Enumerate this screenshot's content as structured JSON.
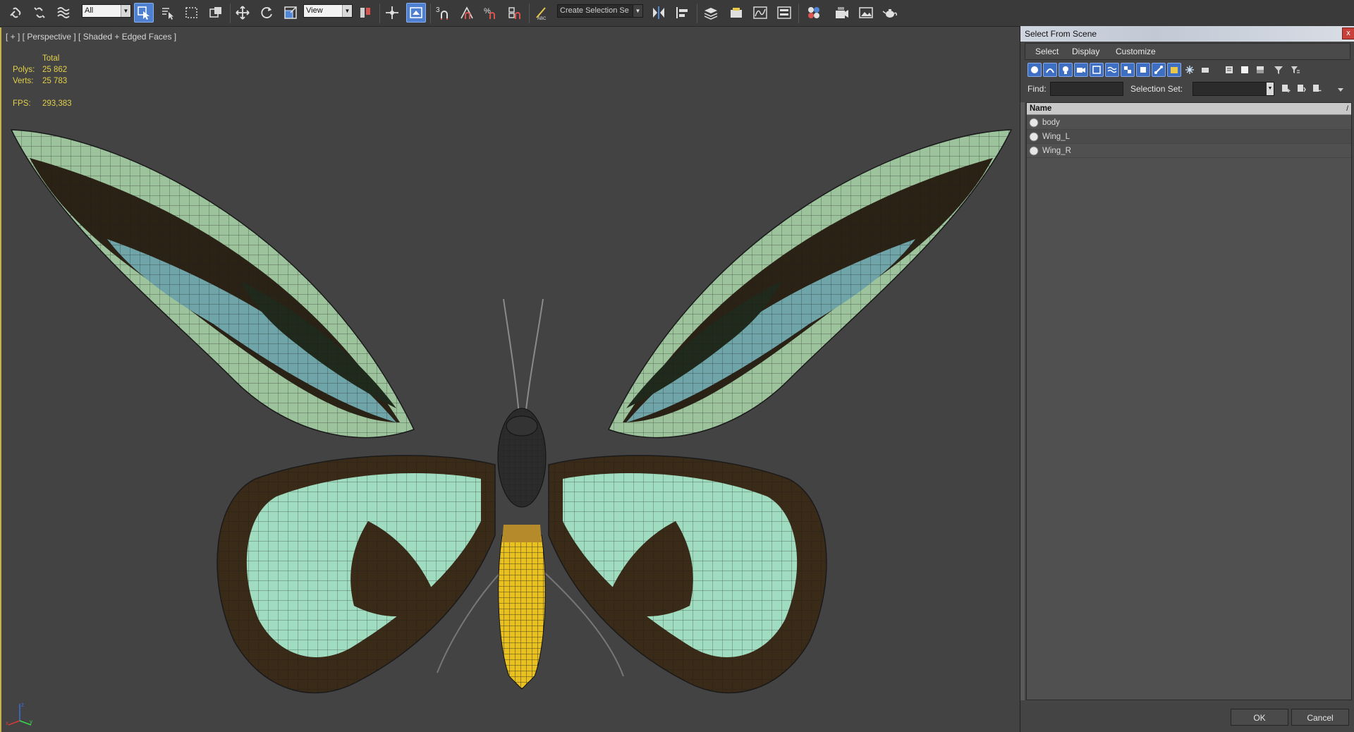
{
  "toolbar": {
    "selection_filter": "All",
    "reference_coord": "View",
    "named_selection": "Create Selection Se",
    "snap_label": "3",
    "percent_snap_label": "%"
  },
  "viewport": {
    "label": "[ + ] [ Perspective ] [ Shaded + Edged Faces ]",
    "stats": {
      "total_label": "Total",
      "polys_label": "Polys:",
      "polys_value": "25 862",
      "verts_label": "Verts:",
      "verts_value": "25 783",
      "fps_label": "FPS:",
      "fps_value": "293,383"
    },
    "axis": {
      "x": "x",
      "y": "y",
      "z": "z"
    },
    "colors": {
      "wing_green": "#9fdcc0",
      "wing_dark": "#2a2014",
      "body_yellow": "#e8c020",
      "mesh": "#1a1a1a"
    }
  },
  "dialog": {
    "title": "Select From Scene",
    "close_glyph": "x",
    "menu": [
      "Select",
      "Display",
      "Customize"
    ],
    "find_label": "Find:",
    "find_value": "",
    "selection_set_label": "Selection Set:",
    "selection_set_value": "",
    "list_header": "Name",
    "list_sort_glyph": "/",
    "items": [
      {
        "name": "body"
      },
      {
        "name": "Wing_L"
      },
      {
        "name": "Wing_R"
      }
    ],
    "ok_label": "OK",
    "cancel_label": "Cancel"
  }
}
